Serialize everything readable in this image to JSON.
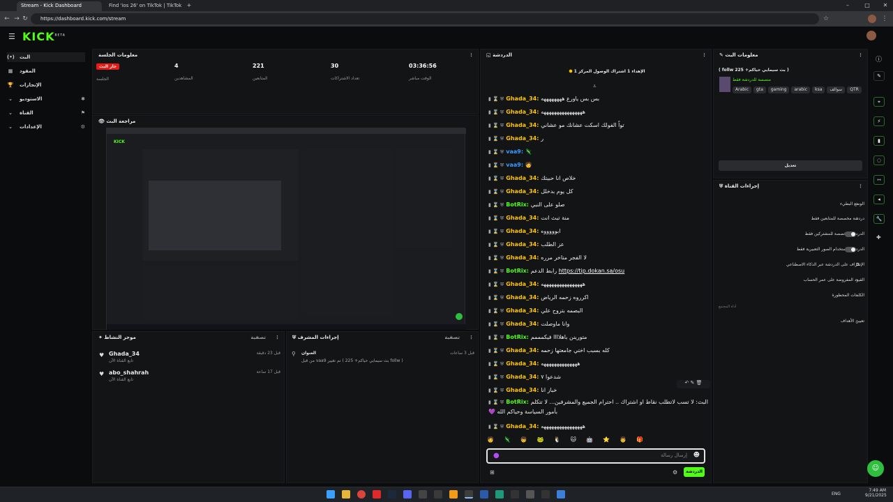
{
  "browser": {
    "tabs": [
      {
        "label": "Stream - Kick Dashboard"
      },
      {
        "label": "Find 'ios 26' on TikTok | TikTok Se"
      }
    ],
    "url": "https://dashboard.kick.com/stream"
  },
  "app": {
    "logo": "KICK",
    "logo_tm": "BETA"
  },
  "sidebar": {
    "items": [
      {
        "label": "البث",
        "icon": "live-icon"
      },
      {
        "label": "المقود",
        "icon": "dashboard-icon"
      },
      {
        "label": "الإنجازات",
        "icon": "trophy-icon"
      },
      {
        "label": "الاستوديو",
        "icon": "studio-icon"
      },
      {
        "label": "القناة",
        "icon": "channel-icon"
      },
      {
        "label": "الإعدادات",
        "icon": "settings-icon"
      }
    ]
  },
  "session": {
    "title": "معلومات الجلسة",
    "stats": [
      {
        "value": "جار البث",
        "label": "الجلسة"
      },
      {
        "value": "4",
        "label": "المشاهدين"
      },
      {
        "value": "221",
        "label": "المتابعين"
      },
      {
        "value": "30",
        "label": "تعداد الاشتراكات"
      },
      {
        "value": "03:36:56",
        "label": "الوقت مباشر"
      }
    ]
  },
  "preview": {
    "title": "مراجعة البث"
  },
  "activity": {
    "title": "موجز النشاط",
    "filter": "تصفية",
    "items": [
      {
        "user": "Ghada_34",
        "desc": "تابع القناة الآن",
        "time": "قبل 23 دقيقة"
      },
      {
        "user": "abo_shahrah",
        "desc": "تابع القناة الآن",
        "time": "قبل 17 ساعة"
      }
    ]
  },
  "modactions": {
    "title": "إجراءات المشرف",
    "filter": "تصفية",
    "entry": {
      "heading": "العنوان",
      "text": "من قبل vaa9 تم تغيير ( بث سيمايي حياكم+ 225 follw )",
      "time": "قبل 3 ساعات"
    }
  },
  "chat": {
    "title": "الدردشة",
    "pinned": "الإهداء 1 اشتراك الوصول المركز 1",
    "messages": [
      {
        "user": "Ghada_34",
        "text": "بس بس ياورع ههههههههه",
        "cls": "ghada"
      },
      {
        "user": "Ghada_34",
        "text": "ههههههههههههههههه",
        "cls": "ghada"
      },
      {
        "user": "Ghada_34",
        "text": "تواً الفولك اسكت عشانك مو عشاني",
        "cls": "ghada"
      },
      {
        "user": "Ghada_34",
        "text": "ر",
        "cls": "ghada"
      },
      {
        "user": "vaa9",
        "text": "🦎",
        "cls": "vaa"
      },
      {
        "user": "vaa9",
        "text": "🧑",
        "cls": "vaa"
      },
      {
        "user": "Ghada_34",
        "text": "خلاص انا حبيتك",
        "cls": "ghada"
      },
      {
        "user": "Ghada_34",
        "text": "كل يوم بدخلل",
        "cls": "ghada"
      },
      {
        "user": "BotRix",
        "text": "صلو على النبي",
        "cls": "bot"
      },
      {
        "user": "Ghada_34",
        "text": "منة تبث انت",
        "cls": "ghada"
      },
      {
        "user": "Ghada_34",
        "text": "ابوووووه",
        "cls": "ghada"
      },
      {
        "user": "Ghada_34",
        "text": "عز الطلب",
        "cls": "ghada"
      },
      {
        "user": "Ghada_34",
        "text": "لا الفجر متاخر مرره",
        "cls": "ghada"
      },
      {
        "user": "BotRix",
        "text": "رابط الدعم",
        "link": "https://tip.dokan.sa/osu",
        "cls": "bot"
      },
      {
        "user": "Ghada_34",
        "text": "ههههههههههههههههه",
        "cls": "ghada"
      },
      {
        "user": "Ghada_34",
        "text": "اكرروه زحمه الرياض",
        "cls": "ghada"
      },
      {
        "user": "Ghada_34",
        "text": "البصمه بتروح علي",
        "cls": "ghada"
      },
      {
        "user": "Ghada_34",
        "text": "وانا ماوصلت",
        "cls": "ghada"
      },
      {
        "user": "BotRix",
        "text": "متورينن باهلاااا فيكمممم",
        "cls": "bot"
      },
      {
        "user": "Ghada_34",
        "text": "كله بسبب اختي جامعتها زحمه",
        "cls": "ghada"
      },
      {
        "user": "Ghada_34",
        "text": "ههههههههههههههه",
        "cls": "ghada"
      },
      {
        "user": "Ghada_34",
        "text": "شدعوا ٧",
        "cls": "ghada"
      },
      {
        "user": "Ghada_34",
        "text": "خباز انا",
        "cls": "ghada"
      },
      {
        "user": "BotRix",
        "text": "البث: لا تسب لاتطلب نقاط او اشتراك .. احترام الجميع والمشرفين... لا تتكلم بأمور السياسة وحياكم الله 💜",
        "cls": "bot"
      },
      {
        "user": "Ghada_34",
        "text": "ههههههههههههههههه",
        "cls": "ghada"
      }
    ],
    "input_placeholder": "إرسال رسالة",
    "send_label": "الدردشة"
  },
  "stream_info": {
    "title": "معلومات البث",
    "stream_title": "( بث سيمايي حياكم+ 225 follw )",
    "category": "منصسة للدردشة فقط",
    "tags": [
      "Arabic",
      "gta",
      "gaming",
      "arabic",
      "ksa",
      "سوالف",
      "QTR"
    ],
    "edit_label": "تعديل"
  },
  "channel_actions": {
    "title": "إجراءات القناة",
    "items": [
      {
        "label": "الوضع البطيء",
        "ctrl": "chevron"
      },
      {
        "label": "دردشة مخصصة للمتابعين فقط",
        "ctrl": "chevron"
      },
      {
        "label": "الدردشة مخصصة للمشتركين فقط",
        "ctrl": "toggle"
      },
      {
        "label": "الدردشة باستخدام الصور التعبيرية فقط",
        "ctrl": "toggle"
      },
      {
        "label": "الإشراف على الدردشة عبر الذكاء الاصطناعي",
        "ctrl": "external"
      },
      {
        "label": "القيود المفروضة على عمر الحساب",
        "ctrl": "chevron"
      },
      {
        "label": "الكلمات المحظورة",
        "ctrl": "chevron"
      }
    ],
    "section": "أداة المجتمع",
    "goals": "تعيين الأهداف"
  },
  "taskbar": {
    "lang": "ENG",
    "time": "7:49 AM",
    "date": "9/21/2025"
  },
  "colors": {
    "accent": "#53fc18",
    "live": "#e91916",
    "ghada": "#ffc400",
    "vaa9": "#3a9bff"
  }
}
